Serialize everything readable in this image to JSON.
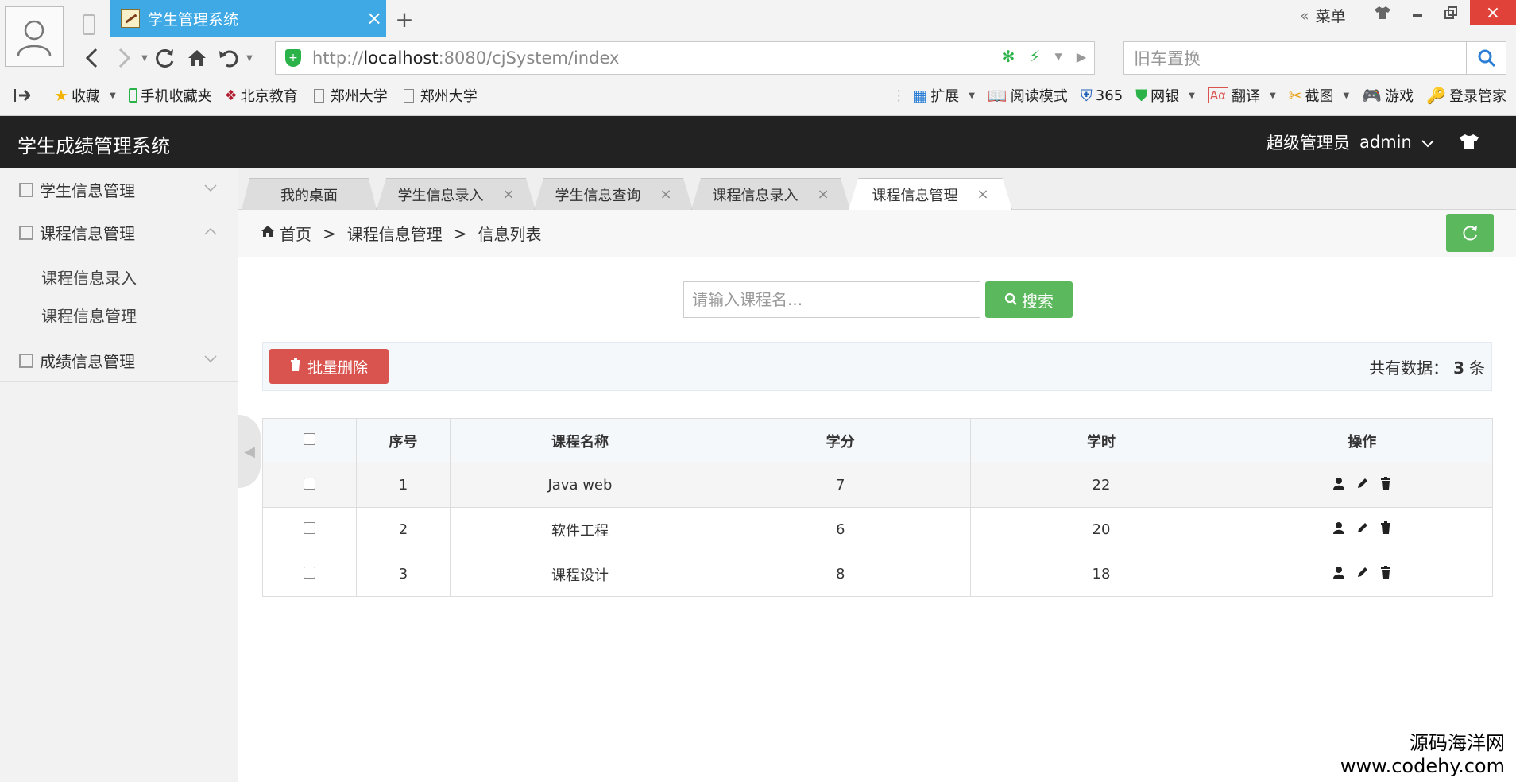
{
  "browser": {
    "tab_title": "学生管理系统",
    "new_tab": "+",
    "menu_label": "菜单",
    "url_scheme": "http://",
    "url_host": "localhost",
    "url_rest": ":8080/cjSystem/index",
    "search_placeholder": "旧车置换",
    "bookmarks_left": [
      {
        "label": "收藏",
        "icon": "star-icon"
      },
      {
        "label": "手机收藏夹",
        "icon": "phone-icon"
      },
      {
        "label": "北京教育",
        "icon": "site-icon"
      },
      {
        "label": "郑州大学",
        "icon": "page-icon"
      },
      {
        "label": "郑州大学",
        "icon": "page-icon"
      }
    ],
    "bookmarks_right": [
      {
        "label": "扩展",
        "icon": "extension-icon"
      },
      {
        "label": "阅读模式",
        "icon": "book-icon"
      },
      {
        "label": "365",
        "icon": "shield-icon"
      },
      {
        "label": "网银",
        "icon": "bank-icon"
      },
      {
        "label": "翻译",
        "icon": "translate-icon"
      },
      {
        "label": "截图",
        "icon": "screenshot-icon"
      },
      {
        "label": "游戏",
        "icon": "gamepad-icon"
      },
      {
        "label": "登录管家",
        "icon": "key-icon"
      }
    ]
  },
  "header": {
    "title": "学生成绩管理系统",
    "role": "超级管理员",
    "username": "admin"
  },
  "sidebar": {
    "groups": [
      {
        "label": "学生信息管理",
        "expanded": false,
        "items": []
      },
      {
        "label": "课程信息管理",
        "expanded": true,
        "items": [
          "课程信息录入",
          "课程信息管理"
        ]
      },
      {
        "label": "成绩信息管理",
        "expanded": false,
        "items": []
      }
    ]
  },
  "tabs": [
    {
      "label": "我的桌面",
      "closable": false
    },
    {
      "label": "学生信息录入",
      "closable": true
    },
    {
      "label": "学生信息查询",
      "closable": true
    },
    {
      "label": "课程信息录入",
      "closable": true
    },
    {
      "label": "课程信息管理",
      "closable": true,
      "active": true
    }
  ],
  "breadcrumb": [
    "首页",
    "课程信息管理",
    "信息列表"
  ],
  "breadcrumb_sep": ">",
  "search": {
    "placeholder": "请输入课程名...",
    "button": "搜索"
  },
  "toolbar": {
    "batch_delete": "批量删除",
    "total_prefix": "共有数据：",
    "total_count": "3",
    "total_suffix": "条"
  },
  "table": {
    "headers": [
      "序号",
      "课程名称",
      "学分",
      "学时",
      "操作"
    ],
    "rows": [
      {
        "no": "1",
        "name": "Java web",
        "credit": "7",
        "hours": "22"
      },
      {
        "no": "2",
        "name": "软件工程",
        "credit": "6",
        "hours": "20"
      },
      {
        "no": "3",
        "name": "课程设计",
        "credit": "8",
        "hours": "18"
      }
    ]
  },
  "watermark": {
    "line1": "源码海洋网",
    "line2": "www.codehy.com"
  },
  "colors": {
    "header_bg": "#222222",
    "success": "#5cb85c",
    "danger": "#d9534f",
    "browser_tab": "#3fa9e6"
  }
}
